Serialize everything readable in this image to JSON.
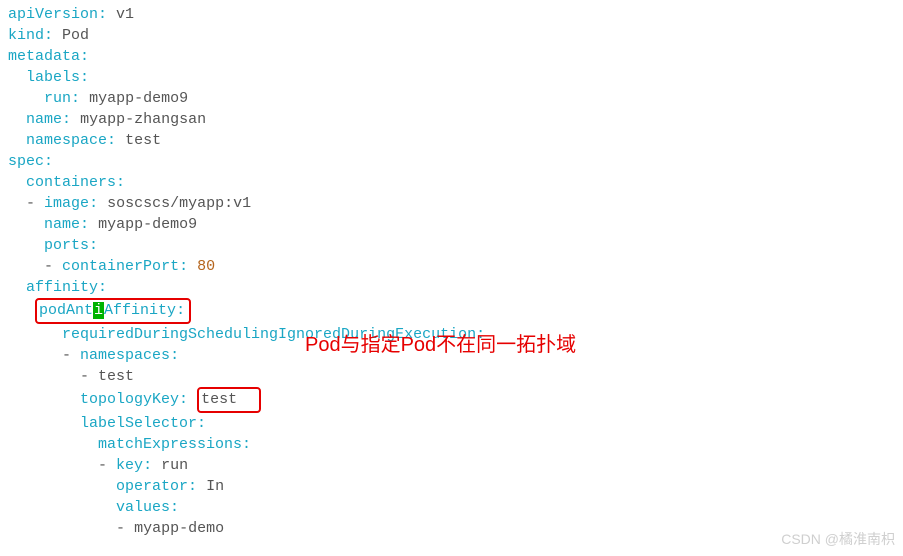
{
  "yaml": {
    "apiVersion_k": "apiVersion",
    "apiVersion_v": "v1",
    "kind_k": "kind",
    "kind_v": "Pod",
    "metadata_k": "metadata",
    "labels_k": "labels",
    "run_k": "run",
    "run_v": "myapp-demo9",
    "name_k": "name",
    "name_v": "myapp-zhangsan",
    "namespace_k": "namespace",
    "namespace_v": "test",
    "spec_k": "spec",
    "containers_k": "containers",
    "image_k": "image",
    "image_v": "soscscs/myapp:v1",
    "cname_k": "name",
    "cname_v": "myapp-demo9",
    "ports_k": "ports",
    "containerPort_k": "containerPort",
    "containerPort_v": "80",
    "affinity_k": "affinity",
    "podAnti_pre": "podAnt",
    "podAnti_i": "i",
    "podAnti_post": "Affinity",
    "required_k": "requiredDuringSchedulingIgnoredDuringExecution",
    "namespaces_k": "namespaces",
    "namespaces_v": "test",
    "topologyKey_k": "topologyKey",
    "topologyKey_v": "test",
    "labelSelector_k": "labelSelector",
    "matchExpressions_k": "matchExpressions",
    "me_key_k": "key",
    "me_key_v": "run",
    "me_operator_k": "operator",
    "me_operator_v": "In",
    "me_values_k": "values",
    "me_values_v": "myapp-demo"
  },
  "annotation": "Pod与指定Pod不在同一拓扑域",
  "watermark": "CSDN @橘淮南枳"
}
